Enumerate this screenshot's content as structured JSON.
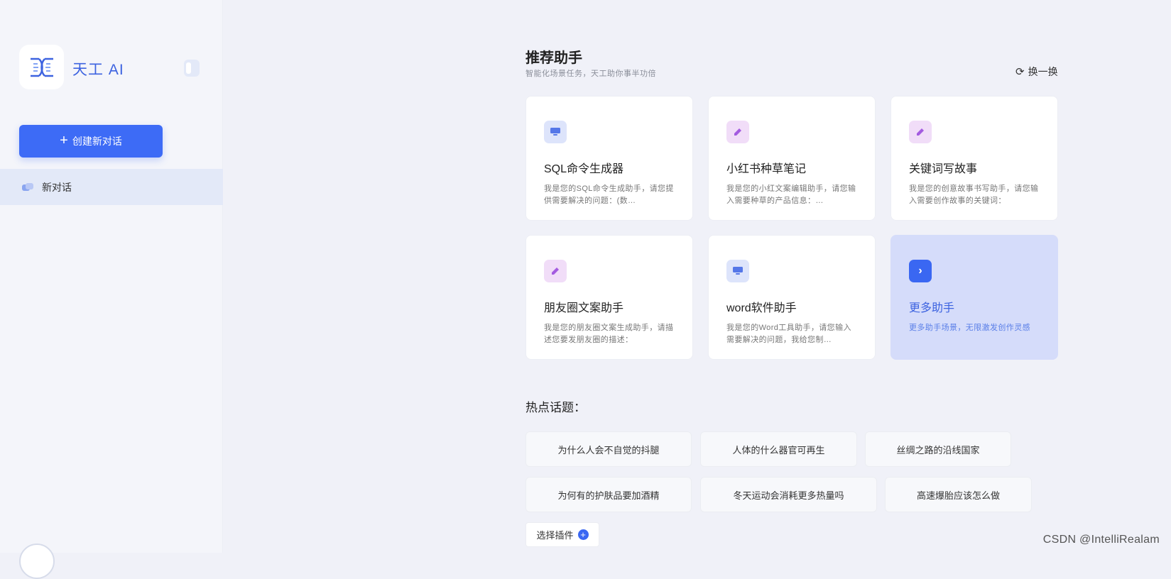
{
  "sidebar": {
    "brand": "天工 AI",
    "new_chat_label": "创建新对话",
    "items": [
      {
        "label": "新对话"
      }
    ]
  },
  "main": {
    "title": "推荐助手",
    "subtitle": "智能化场景任务，天工助你事半功倍",
    "refresh_label": "换一换",
    "cards": [
      {
        "name": "SQL命令生成器",
        "desc": "我是您的SQL命令生成助手，请您提供需要解决的问题：(数…",
        "icon": "monitor-icon"
      },
      {
        "name": "小红书种草笔记",
        "desc": "我是您的小红文案编辑助手，请您输入需要种草的产品信息：…",
        "icon": "pen-icon"
      },
      {
        "name": "关键词写故事",
        "desc": "我是您的创意故事书写助手，请您输入需要创作故事的关键词：",
        "icon": "pen-icon"
      },
      {
        "name": "朋友圈文案助手",
        "desc": "我是您的朋友圈文案生成助手，请描述您要发朋友圈的描述：",
        "icon": "pen-icon"
      },
      {
        "name": "word软件助手",
        "desc": "我是您的Word工具助手，请您输入需要解决的问题，我给您制…",
        "icon": "monitor-icon"
      },
      {
        "name": "更多助手",
        "desc": "更多助手场景，无限激发创作灵感",
        "icon": "chevron-right-icon"
      }
    ],
    "hot_title": "热点话题：",
    "topics": [
      "为什么人会不自觉的抖腿",
      "人体的什么器官可再生",
      "丝绸之路的沿线国家",
      "为何有的护肤品要加酒精",
      "冬天运动会消耗更多热量吗",
      "高速爆胎应该怎么做"
    ],
    "plugin_label": "选择插件"
  },
  "footer": {
    "credit": "CSDN @IntelliRealam"
  },
  "colors": {
    "accent": "#3d6bf6",
    "brand_text": "#3d63e0",
    "more_card_bg": "#d5dcfa"
  }
}
